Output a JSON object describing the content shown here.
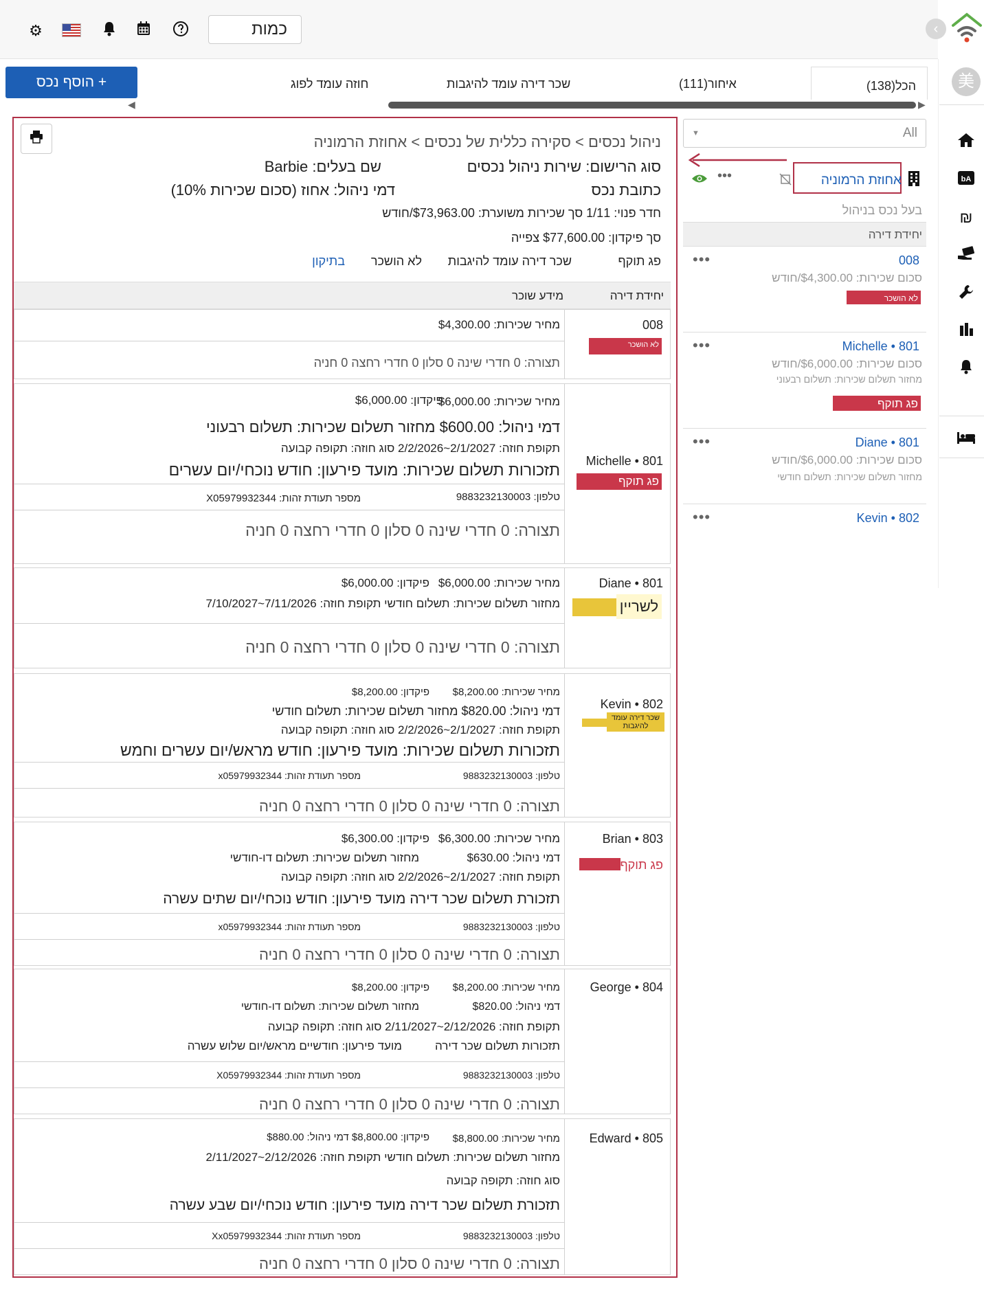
{
  "topbar": {
    "search_value": "כמות",
    "back_icon": "chevron-left-icon"
  },
  "sidebar_avatar": "美",
  "toolbar": {
    "add_label": "+ הוסף נכס",
    "tabs": [
      {
        "label": "הכל(138)"
      },
      {
        "label": "איחור(111)"
      },
      {
        "label": "שכר דירה עומד להיגבות"
      },
      {
        "label": "חוזה עומד לפוג"
      }
    ]
  },
  "list_panel": {
    "filter_value": "All",
    "property_name": "אחוזת הרמוניה",
    "owner_label": "בעל נכס בניהול",
    "section_header": "יחידת דירה",
    "units": [
      {
        "num": "008",
        "name": "",
        "rent": "סכום שכירות: $4,300.00/חודש",
        "note": "",
        "badge": "לא הושכר"
      },
      {
        "num": "801",
        "name": "Michelle",
        "rent": "סכום שכירות: $6,000.00/חודש",
        "note": "מחזור תשלום שכירות: תשלום רבעוני",
        "badge": "פג תוקף"
      },
      {
        "num": "801",
        "name": "Diane",
        "rent": "סכום שכירות: $6,000.00/חודש",
        "note": "מחזור תשלום שכירות: תשלום חודשי",
        "badge": ""
      },
      {
        "num": "802",
        "name": "Kevin",
        "rent": "",
        "note": "",
        "badge": ""
      }
    ]
  },
  "detail": {
    "breadcrumb": "ניהול נכסים > סקירה כללית של נכסים > אחוזת הרמוניה",
    "reg_type": "סוג הרישום: שירות ניהול נכסים",
    "owner": "שם בעלים: Barbie",
    "address": "כתובת נכס",
    "mgmt_fee": "דמי ניהול: אחוז (סכום שכירות 10%)",
    "vacant": "חדר פנוי: 1/11 סך שכירות משוערת: $73,963.00/חודש",
    "deposit": "סך פיקדון: $77,600.00 צפייה",
    "status_tabs": [
      "פג תוקף",
      "שכר דירה עומד להיגבות",
      "לא הושכר",
      "בתיקון"
    ],
    "col_unit": "יחידת דירה",
    "col_tenant": "מידע שוכר",
    "units": [
      {
        "unit": "008",
        "badge": "לא הושכר",
        "rent": "מחיר שכירות: $4,300.00",
        "layout": "תצורה: 0 חדרי שינה 0 סלון 0 חדרי רחצה 0 חניה"
      },
      {
        "unit": "801 • Michelle",
        "badge": "פג תוקף",
        "rent": "מחיר שכירות: $6,000.00",
        "deposit": "פיקדון: $6,000.00",
        "fee_cycle": "דמי ניהול: $600.00 מחזור תשלום שכירות: תשלום רבעוני",
        "period": "תקופת חוזה: 2/1/2027~2/2/2026 סוג חוזה: תקופה קבועה",
        "reminder": "תזכורות תשלום שכירות: מועד פירעון: חודש נוכחי/יום עשרים",
        "phone": "טלפון: 9883232130003",
        "id": "מספר תעודת זהות: X05979932344",
        "layout": "תצורה: 0 חדרי שינה 0 סלון 0 חדרי רחצה 0 חניה"
      },
      {
        "unit": "801 • Diane",
        "badge": "לשריין",
        "rent": "מחיר שכירות: $6,000.00",
        "deposit": "פיקדון: $6,000.00",
        "cycle_period": "מחזור תשלום שכירות: תשלום חודשי תקופת חוזה: 7/11/2026~7/10/2027",
        "layout": "תצורה: 0 חדרי שינה 0 סלון 0 חדרי רחצה 0 חניה"
      },
      {
        "unit": "802 • Kevin",
        "badge": "שכר דירה עומד להיגבות",
        "rent": "מחיר שכירות: $8,200.00",
        "deposit": "פיקדון: $8,200.00",
        "fee_cycle": "דמי ניהול: $820.00 מחזור תשלום שכירות: תשלום חודשי",
        "period": "תקופת חוזה: 2/1/2027~2/2/2026 סוג חוזה: תקופה קבועה",
        "reminder": "תזכורות תשלום שכירות: מועד פירעון: חודש מראש/יום עשרים וחמש",
        "phone": "טלפון: 9883232130003",
        "id": "מספר תעודת זהות: x05979932344",
        "layout": "תצורה: 0 חדרי שינה 0 סלון 0 חדרי רחצה 0 חניה"
      },
      {
        "unit": "803 • Brian",
        "badge": "פג תוקף",
        "rent": "מחיר שכירות: $6,300.00",
        "deposit": "פיקדון: $6,300.00",
        "fee": "דמי ניהול: $630.00",
        "cycle": "מחזור תשלום שכירות: תשלום דו-חודשי",
        "period": "תקופת חוזה: 2/1/2027~2/2/2026 סוג חוזה: תקופה קבועה",
        "reminder": "תזכורת תשלום שכר דירה  מועד פירעון: חודש נוכחי/יום שתים עשרה",
        "phone": "טלפון: 9883232130003",
        "id": "מספר תעודת זהות: x05979932344",
        "layout": "תצורה: 0 חדרי שינה 0 סלון 0 חדרי רחצה 0 חניה"
      },
      {
        "unit": "804 • George",
        "rent": "מחיר שכירות: $8,200.00",
        "deposit": "פיקדון: $8,200.00",
        "fee": "דמי ניהול: $820.00",
        "cycle": "מחזור תשלום שכירות: תשלום דו-חודשי",
        "period": "תקופת חוזה: 2/12/2026~2/11/2027 סוג חוזה: תקופה קבועה",
        "reminder_a": "תזכורות תשלום שכר דירה",
        "reminder_b": "מועד פירעון: חודשיים מראש/יום שלוש עשרה",
        "phone": "טלפון: 9883232130003",
        "id": "מספר תעודת זהות: X05979932344",
        "layout": "תצורה: 0 חדרי שינה 0 סלון 0 חדרי רחצה 0 חניה"
      },
      {
        "unit": "805 • Edward",
        "rent": "מחיר שכירות: $8,800.00",
        "deposit_fee": "פיקדון: $8,800.00 דמי ניהול: $880.00",
        "cycle_period": "מחזור תשלום שכירות: תשלום חודשי תקופת חוזה: 2/12/2026~2/11/2027",
        "ctype": "סוג חוזה: תקופה קבועה",
        "reminder": "תזכורת תשלום שכר דירה  מועד פירעון: חודש נוכחי/יום שבע עשרה",
        "phone": "טלפון: 9883232130003",
        "id": "מספר תעודת זהות: Xx05979932344",
        "layout": "תצורה: 0 חדרי שינה 0 סלון 0 חדרי רחצה 0 חניה"
      }
    ]
  },
  "colors": {
    "accent": "#1d5fb5",
    "danger": "#c9374a",
    "warning": "#e8c53a",
    "highlight_border": "#b13148"
  }
}
